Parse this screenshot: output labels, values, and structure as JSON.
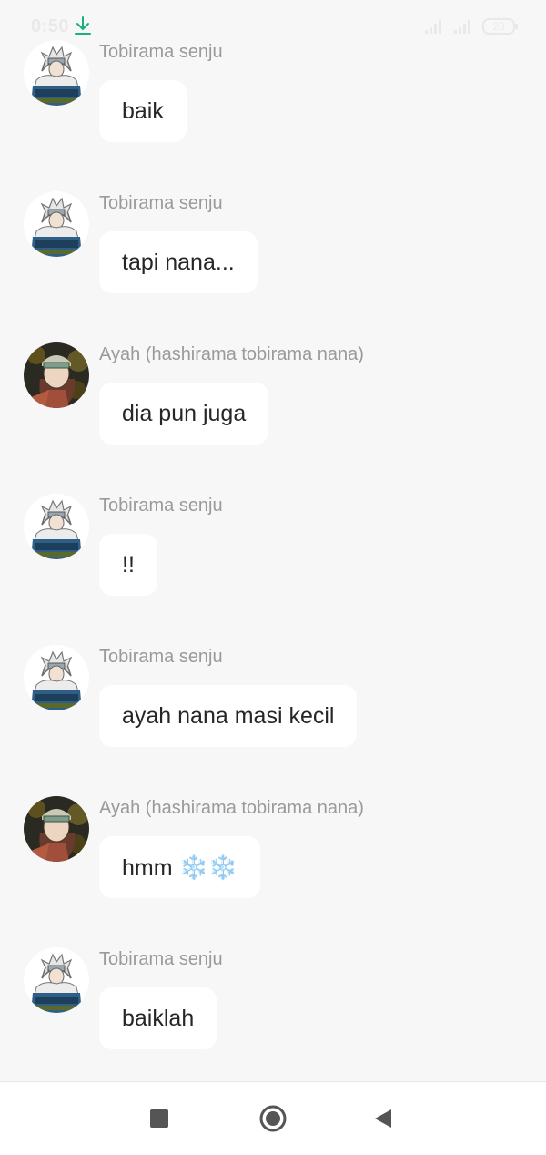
{
  "status_bar": {
    "time": "0:50",
    "download_icon": "download-icon",
    "battery_level": "28",
    "colors": {
      "time": "#e9e9e9",
      "download": "#19b07a"
    }
  },
  "messages": [
    {
      "sender": "Tobirama senju",
      "text": "baik",
      "avatar": "tobirama-avatar"
    },
    {
      "sender": "Tobirama senju",
      "text": "tapi nana...",
      "avatar": "tobirama-avatar"
    },
    {
      "sender": "Ayah (hashirama tobirama nana)",
      "text": "dia pun juga",
      "avatar": "ayah-avatar"
    },
    {
      "sender": "Tobirama senju",
      "text": "!!",
      "avatar": "tobirama-avatar"
    },
    {
      "sender": "Tobirama senju",
      "text": "ayah nana masi kecil",
      "avatar": "tobirama-avatar"
    },
    {
      "sender": "Ayah (hashirama tobirama nana)",
      "text": "hmm",
      "emoji": "❄️❄️",
      "avatar": "ayah-avatar"
    },
    {
      "sender": "Tobirama senju",
      "text": "baiklah",
      "avatar": "tobirama-avatar"
    }
  ],
  "nav_bar": {
    "recents_icon": "square-icon",
    "home_icon": "circle-icon",
    "back_icon": "triangle-back-icon"
  },
  "colors": {
    "background": "#f7f7f7",
    "bubble": "#ffffff",
    "sender_text": "#9a9a9a",
    "message_text": "#262626"
  }
}
